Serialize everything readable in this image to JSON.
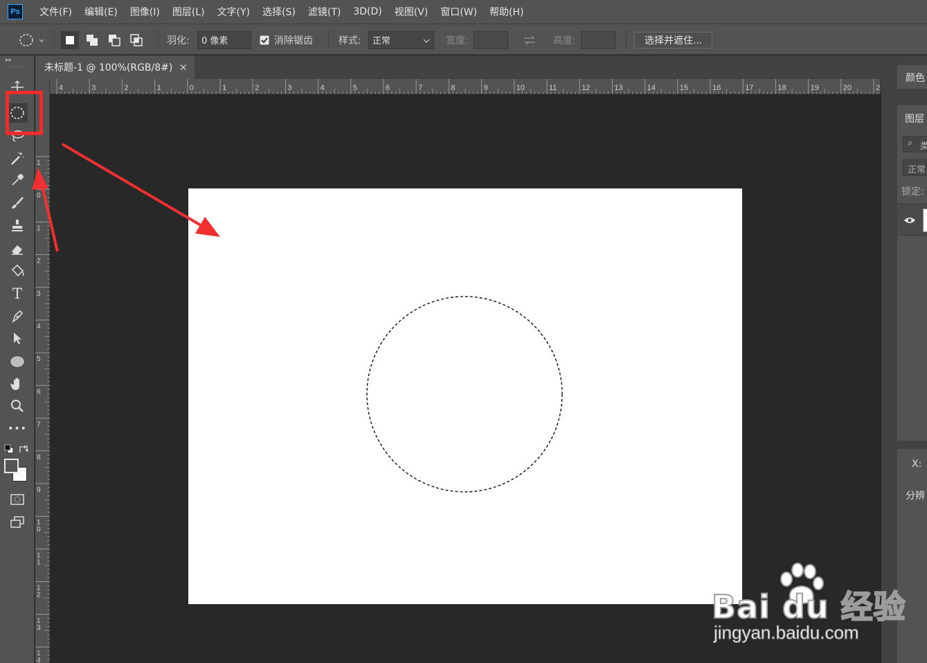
{
  "app": {
    "logo": "Ps"
  },
  "menubar": {
    "items": [
      "文件(F)",
      "编辑(E)",
      "图像(I)",
      "图层(L)",
      "文字(Y)",
      "选择(S)",
      "滤镜(T)",
      "3D(D)",
      "视图(V)",
      "窗口(W)",
      "帮助(H)"
    ]
  },
  "options": {
    "feather_label": "羽化:",
    "feather_value": "0 像素",
    "antialias_label": "消除锯齿",
    "antialias_checked": true,
    "style_label": "样式:",
    "style_value": "正常",
    "width_label": "宽度:",
    "height_label": "高度:",
    "select_mask_button": "选择并遮住..."
  },
  "document_tab": {
    "title": "未标题-1 @ 100%(RGB/8#)",
    "close": "×"
  },
  "rulers": {
    "top": [
      "4",
      "3",
      "2",
      "1",
      "0",
      "1",
      "2",
      "3",
      "4",
      "5",
      "6",
      "7",
      "8",
      "9",
      "10",
      "11",
      "12",
      "13",
      "14",
      "15",
      "16",
      "17",
      "18",
      "19",
      "20",
      "2"
    ],
    "left": [
      "1",
      "0",
      "1",
      "2",
      "3",
      "4",
      "5",
      "6",
      "7",
      "8",
      "9",
      "10",
      "11",
      "12",
      "13",
      "14"
    ]
  },
  "toolbar": {
    "tools": [
      "move-tool",
      "elliptical-marquee-tool",
      "lasso-tool",
      "magic-wand-tool",
      "eyedropper-tool",
      "brush-tool",
      "clone-stamp-tool",
      "eraser-tool",
      "paint-bucket-tool",
      "type-tool",
      "pen-tool",
      "path-selection-tool",
      "ellipse-tool",
      "hand-tool",
      "zoom-tool",
      "more-tools",
      "default-colors",
      "swap-colors",
      "quick-mask",
      "screen-mode"
    ],
    "active_tool": "elliptical-marquee-tool",
    "type_glyph": "T",
    "more_glyph": "•••"
  },
  "right_panels": {
    "color_tab": "颜色",
    "layers_tab": "图层",
    "search_text": "类",
    "blend_mode": "正常",
    "lock_label": "锁定:",
    "x_label": "X:",
    "resolution_label": "分辨"
  },
  "watermark": {
    "brand": "Bai du 经验",
    "url": "jingyan.baidu.com"
  },
  "colors": {
    "ui_panel": "#535353",
    "canvas_bg": "#282828",
    "document": "#ffffff",
    "annotation": "#f22b2b",
    "ps_accent": "#31a8ff"
  }
}
